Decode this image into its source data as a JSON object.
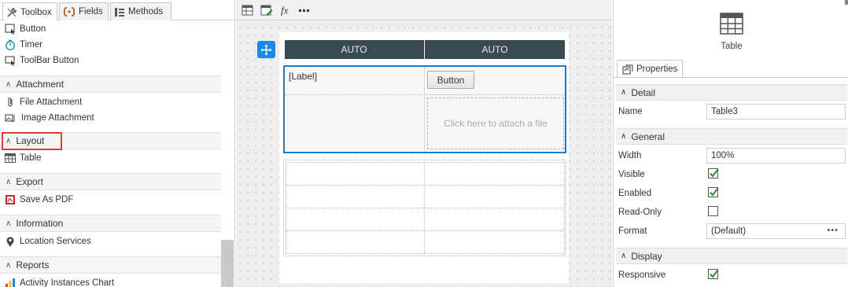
{
  "toolbox": {
    "tabs": [
      {
        "label": "Toolbox",
        "icon": "wrench-icon"
      },
      {
        "label": "Fields",
        "icon": "brackets-icon"
      },
      {
        "label": "Methods",
        "icon": "methods-icon"
      }
    ],
    "items_top": [
      {
        "label": "Button",
        "icon": "button-control-icon"
      },
      {
        "label": "Timer",
        "icon": "timer-icon"
      },
      {
        "label": "ToolBar Button",
        "icon": "toolbar-button-icon"
      }
    ],
    "sections": {
      "attachment": {
        "label": "Attachment",
        "items": [
          "File Attachment",
          "Image Attachment"
        ]
      },
      "layout": {
        "label": "Layout",
        "items": [
          "Table"
        ]
      },
      "export": {
        "label": "Export",
        "items": [
          "Save As PDF"
        ]
      },
      "information": {
        "label": "Information",
        "items": [
          "Location Services"
        ]
      },
      "reports": {
        "label": "Reports",
        "items": [
          "Activity Instances Chart"
        ]
      }
    }
  },
  "canvas": {
    "columns": [
      "AUTO",
      "AUTO"
    ],
    "label_text": "[Label]",
    "button_label": "Button",
    "attach_placeholder": "Click here to attach a file"
  },
  "properties": {
    "control_name": "Table",
    "tab_label": "Properties",
    "sections": {
      "detail": "Detail",
      "general": "General",
      "display": "Display"
    },
    "fields": {
      "name_label": "Name",
      "name_value": "Table3",
      "width_label": "Width",
      "width_value": "100%",
      "visible_label": "Visible",
      "visible_checked": true,
      "enabled_label": "Enabled",
      "enabled_checked": true,
      "readonly_label": "Read-Only",
      "readonly_checked": false,
      "format_label": "Format",
      "format_value": "(Default)",
      "responsive_label": "Responsive",
      "responsive_checked": true
    }
  },
  "colors": {
    "selection": "#1b7dc9",
    "column_header": "#3a4a52",
    "highlight": "#e03c3c",
    "checkmark": "#2e8b2e"
  }
}
